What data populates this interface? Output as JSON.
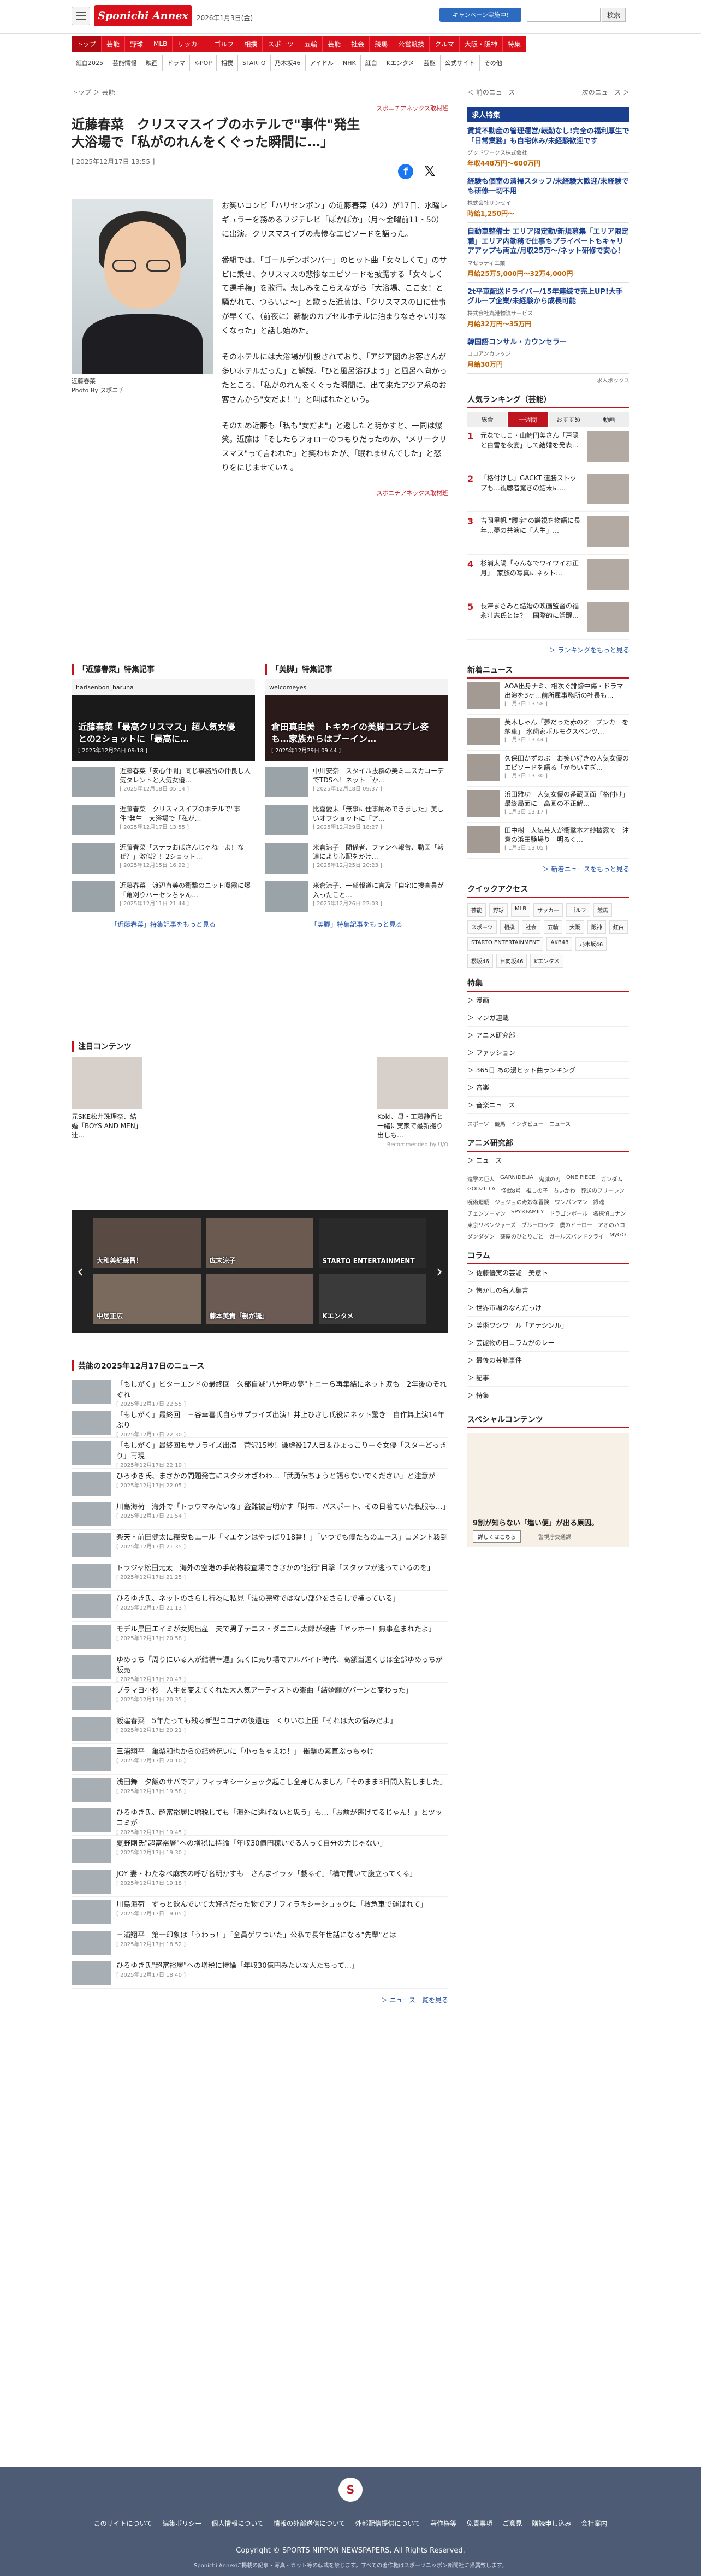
{
  "header": {
    "logo": "Sponichi Annex",
    "date": "2026年1月3日(金)",
    "campaign": "キャンペーン実施中!",
    "search_button": "検索",
    "categories": [
      "トップ",
      "芸能",
      "野球",
      "MLB",
      "サッカー",
      "ゴルフ",
      "相撲",
      "スポーツ",
      "五輪",
      "芸能",
      "社会",
      "競馬",
      "公営競技",
      "クルマ",
      "大阪・阪神",
      "特集"
    ],
    "subnav": [
      "紅白2025",
      "芸能情報",
      "映画",
      "ドラマ",
      "K-POP",
      "相撲",
      "STARTO",
      "乃木坂46",
      "アイドル",
      "NHK",
      "紅白",
      "Kエンタメ",
      "芸能",
      "公式サイト",
      "その他"
    ]
  },
  "breadcrumb": "トップ ＞ 芸能",
  "prevnext": {
    "prev": "＜ 前のニュース",
    "next": "次のニュース ＞"
  },
  "article": {
    "source": "スポニチアネックス取材班",
    "headline": "近藤春菜　クリスマスイブのホテルで\"事件\"発生　大浴場で「私がのれんをくぐった瞬間に…」",
    "meta": "[ 2025年12月17日 13:55 ]",
    "photo_caption_1": "近藤春菜",
    "photo_caption_2": "Photo By スポニチ",
    "paragraphs": [
      "お笑いコンビ「ハリセンボン」の近藤春菜（42）が17日、水曜レギュラーを務めるフジテレビ「ぽかぽか」（月〜金曜前11・50）に出演。クリスマスイブの悲惨なエピソードを語った。",
      "番組では、「ゴールデンボンバー」のヒット曲「女々しくて」のサビに乗せ、クリスマスの悲惨なエピソードを披露する「女々しくて選手権」を敢行。悲しみをこらえながら「大浴場、ここ女！と騒がれて、つらいよ〜」と歌った近藤は、「クリスマスの日に仕事が早くて、（前夜に）新橋のカプセルホテルに泊まりなきゃいけなくなった」と話し始めた。",
      "そのホテルには大浴場が併設されており、「アジア圏のお客さんが多いホテルだった」と解説。「ひと風呂浴びよう」と風呂へ向かったところ、「私がのれんをくぐった瞬間に、出て来たアジア系のお客さんから\"女だよ！\"」と叫ばれたという。",
      "そのため近藤も「私も\"女だよ\"」と返したと明かすと、一同は爆笑。近藤は「そしたらフォローのつもりだったのか、\"メリークリスマス\"って言われた」と笑わせたが、「眠れませんでした」と怒りをにじませていた。"
    ],
    "source_bottom": "スポニチアネックス取材班"
  },
  "features": [
    {
      "title": "「近藤春菜」特集記事",
      "video_head": "harisenbon_haruna",
      "video_text": "近藤春菜「最高クリスマス」超人気女優との2ショットに「最高に…",
      "video_time": "[ 2025年12月26日 09:18 ]",
      "items": [
        {
          "text": "近藤春菜「安心仲間」同じ事務所の仲良し人気タレントと人気女優…",
          "time": "[ 2025年12月18日 05:14 ]"
        },
        {
          "text": "近藤春菜　クリスマスイブのホテルで\"事件\"発生　大浴場で「私が…",
          "time": "[ 2025年12月17日 13:55 ]"
        },
        {
          "text": "近藤春菜「ステラおばさんじゃねーよ！なぜ？」激似？！2ショット…",
          "time": "[ 2025年12月15日 16:22 ]"
        },
        {
          "text": "近藤春菜　渡辺直美の衝撃のニット曝露に爆「角刈りハーセンちゃん…",
          "time": "[ 2025年12月11日 21:44 ]"
        }
      ],
      "more": "「近藤春菜」特集記事をもっと見る"
    },
    {
      "title": "「美脚」特集記事",
      "video_head": "welcomeyes",
      "video_text": "倉田真由美　トキカイの美脚コスプレ姿も…家族からはブーイン…",
      "video_time": "[ 2025年12月29日 09:44 ]",
      "items": [
        {
          "text": "中川安奈　スタイル抜群の美ミニスカコーデでTDSへ！ネット「か…",
          "time": "[ 2025年12月18日 09:37 ]"
        },
        {
          "text": "比嘉愛未「無事に仕事納めできました」美しいオフショットに「ア…",
          "time": "[ 2025年12月29日 18:27 ]"
        },
        {
          "text": "米倉涼子　関係者、ファンへ報告、動画「報道により心配をかけ…",
          "time": "[ 2025年12月25日 20:23 ]"
        },
        {
          "text": "米倉涼子、一部報道に言及「自宅に捜査員が入ったこと…",
          "time": "[ 2025年12月26日 22:03 ]"
        }
      ],
      "more": "「美脚」特集記事をもっと見る"
    }
  ],
  "notice": {
    "title": "注目コンテンツ",
    "items": [
      {
        "text": "元SKE松井珠理奈、結婚「BOYS AND MEN」辻…"
      },
      {
        "text": ""
      },
      {
        "text": ""
      },
      {
        "text": ""
      },
      {
        "text": "Koki、母・工藤静香と一緒に実家で最新撮り出しも…"
      }
    ],
    "credit": "Recommended by U/O"
  },
  "carousel": {
    "cells": [
      "大和美紀練習！",
      "広末涼子",
      "STARTO ENTERTAINMENT",
      "中居正広",
      "藤本美貴「親が誕」",
      "Kエンタメ"
    ],
    "left": "‹",
    "right": "›"
  },
  "daily": {
    "title": "芸能の2025年12月17日のニュース",
    "items": [
      {
        "text": "「もしがく」ビターエンドの最終回　久部自滅\"八分呪の夢\"トニーら再集結にネット涙も　2年後のそれぞれ",
        "time": "[ 2025年12月17日 22:55 ]"
      },
      {
        "text": "「もしがく」最終回　三谷幸喜氏自らサプライズ出演！井上ひさし氏役にネット驚き　自作舞上演14年ぶり",
        "time": "[ 2025年12月17日 22:30 ]"
      },
      {
        "text": "「もしがく」最終回もサプライズ出演　菅沢15秒！謙虚役17人目＆ひょっこりーぐ女優「スターどっきり」再現",
        "time": "[ 2025年12月17日 22:19 ]"
      },
      {
        "text": "ひろゆき氏、まさかの間題発言にスタジオざわわ…「武勇伝ちょうと語らないでください」と注意が",
        "time": "[ 2025年12月17日 22:05 ]"
      },
      {
        "text": "川島海荷　海外で「トラウマみたいな」盗難被害明かす「財布、パスポート、その日着ていた私服も…」",
        "time": "[ 2025年12月17日 21:54 ]"
      },
      {
        "text": "楽天・前田健太に糧安もエール「マエケンはやっぱり18番！」「いつでも僕たちのエース」コメント殺到",
        "time": "[ 2025年12月17日 21:35 ]"
      },
      {
        "text": "トラジャ松田元太　海外の空港の手荷物検査場できさかの\"犯行\"目撃「スタッフが逃っているのを」",
        "time": "[ 2025年12月17日 21:25 ]"
      },
      {
        "text": "ひろゆき氏、ネットのさらし行為に私見「法の完璧ではない部分をさらしで補っている」",
        "time": "[ 2025年12月17日 21:13 ]"
      },
      {
        "text": "モデル黒田エイミが女児出産　夫で男子テニス・ダニエル太郎が報告「ヤッホー！無事産まれたよ」",
        "time": "[ 2025年12月17日 20:58 ]"
      },
      {
        "text": "ゆめっち「周りにいる人が結構幸運」気くに売り場でアルバイト時代、高額当選くじは全部ゆめっちが販売",
        "time": "[ 2025年12月17日 20:47 ]"
      },
      {
        "text": "ブラマヨ小杉　人生を変えてくれた大人気アーティストの楽曲「結婚願がパーンと変わった」",
        "time": "[ 2025年12月17日 20:35 ]"
      },
      {
        "text": "飯窪春菜　5年たっても残る新型コロナの後遺症　くりいむ上田「それは大の悩みだよ」",
        "time": "[ 2025年12月17日 20:21 ]"
      },
      {
        "text": "三浦翔平　亀梨和也からの結婚祝いに「小っちゃえわ！」 衝撃の素直ぶっちゃけ",
        "time": "[ 2025年12月17日 20:10 ]"
      },
      {
        "text": "浅田舞　夕飯のサバでアナフィラキシーショック起こし全身じんましん「そのまま3日間入院しました」",
        "time": "[ 2025年12月17日 19:58 ]"
      },
      {
        "text": "ひろゆき氏、超富裕層に増税しても「海外に逃げないと思う」も…「お前が逃げてるじゃん！」とツッコミが",
        "time": "[ 2025年12月17日 19:45 ]"
      },
      {
        "text": "夏野剛氏\"超富裕層\"への増税に持論「年収30億円稼いでる人って自分の力じゃない」",
        "time": "[ 2025年12月17日 19:30 ]"
      },
      {
        "text": "JOY 妻・わたなべ麻衣の呼び名明かすも　さんまイラッ「戯るぞ」「構で聞いて腹立ってくる」",
        "time": "[ 2025年12月17日 19:18 ]"
      },
      {
        "text": "川島海荷　ずっと飲んでいて大好きだった物でアナフィラキシーショックに「救急車で運ばれて」",
        "time": "[ 2025年12月17日 19:05 ]"
      },
      {
        "text": "三浦翔平　第一印象は「うわっ！」「全員ゲワついた」公私で長年世話になる\"先輩\"とは",
        "time": "[ 2025年12月17日 18:52 ]"
      },
      {
        "text": "ひろゆき氏\"超富裕層\"への増税に持論「年収30億円みたいな人たちって…」",
        "time": "[ 2025年12月17日 18:40 ]"
      }
    ],
    "more": "＞ ニュース一覧を見る"
  },
  "side": {
    "jobs_title": "求人特集",
    "jobs": [
      {
        "title": "賃貸不動産の管理運営/転勤なし!完全の福利厚生で「日常業務」も自宅休み/未経験歓迎です",
        "company": "グッドワークス株式会社",
        "wage": "年収448万円〜600万円"
      },
      {
        "title": "経験も個室の清掃スタッフ/未経験大歓迎/未経験でも研修一切不用",
        "company": "株式会社サンセイ",
        "wage": "時給1,250円〜"
      },
      {
        "title": "自動車整備士 エリア限定勤/新規募集「エリア限定職」エリア内勤務で仕事もプライベートもキャリアアップも両立/月収25万〜/ネット研修で安心！",
        "company": "マセラティ工業",
        "wage": "月給25万5,000円〜32万4,000円"
      },
      {
        "title": "2t平車配送ドライバー/15年連続で売上UP!大手グループ企業/未経験から成長可能",
        "company": "株式会社丸港物流サービス",
        "wage": "月給32万円〜35万円"
      },
      {
        "title": "韓国語コンサル・カウンセラー",
        "company": "ココアンカレッジ",
        "wage": "月給30万円"
      }
    ],
    "jobs_credit": "求人ボックス",
    "rank_title": "人気ランキング（芸能）",
    "rank_tabs": [
      "総合",
      "一週間",
      "おすすめ",
      "動画"
    ],
    "rank": [
      {
        "no": "1",
        "text": "元なでしこ・山崎円美さん「戸隠と白雪を夜宴」して結婚を発表…"
      },
      {
        "no": "2",
        "text": "「格付けし」GACKT 連勝ストップも…視聴者驚きの結末に…"
      },
      {
        "no": "3",
        "text": "吉岡里帆 \"腰字\"の謙視を物語に長年…夢の共演に「人生」…"
      },
      {
        "no": "4",
        "text": "杉浦太陽「みんなでワイワイお正月」　家族の写真にネット…"
      },
      {
        "no": "5",
        "text": "長澤まさみと結婚の映画監督の福永壮志氏とは？　国際的に活躍…"
      }
    ],
    "rank_more": "＞ ランキングをもっと見る",
    "news_title": "新着ニュース",
    "news": [
      {
        "text": "AOA出身ナミ、相次ぐ誹謗中傷・ドラマ出演を3ヶ…前所属事務所の社長も…",
        "time": "[ 1月3日 13:58 ]"
      },
      {
        "text": "芙木しゃん「夢だった赤のオープンカーを納車」 氷歯家ボルモクスベンツ…",
        "time": "[ 1月3日 13:44 ]"
      },
      {
        "text": "久保田かずのぶ　お笑い好きの人気女優のエピソードを語る「かわいすぎ…",
        "time": "[ 1月3日 13:30 ]"
      },
      {
        "text": "浜田雅功　人気女優の番蔵画面「格付け」最終局面に　高画の不正解…",
        "time": "[ 1月3日 13:17 ]"
      },
      {
        "text": "田中樹　人気芸人が衝撃本才紗披露で　注意の浜田験場り　明るく…",
        "time": "[ 1月3日 13:05 ]"
      }
    ],
    "news_more": "＞ 新着ニュースをもっと見る",
    "qa_title": "クイックアクセス",
    "qa": [
      "芸能",
      "野球",
      "MLB",
      "サッカー",
      "ゴルフ",
      "競馬",
      "スポーツ",
      "相撲",
      "社会",
      "五輪",
      "大阪",
      "阪神",
      "紅白",
      "STARTO ENTERTAINMENT",
      "AKB48",
      "乃木坂46",
      "櫻坂46",
      "日向坂46",
      "Kエンタメ"
    ],
    "tokushu_title": "特集",
    "tokushu": [
      "＞ 漫画",
      "＞ マンガ連載",
      "＞ アニメ研究部",
      "＞ ファッション",
      "＞ 365日 あの漫ヒット曲ランキング",
      "＞ 音楽",
      "＞ 音楽ニュース"
    ],
    "tokushu_extra": [
      "スポーツ",
      "競馬",
      "インタビュー",
      "ニュース"
    ],
    "anime_title": "アニメ研究部",
    "anime_sub": "＞ ニュース",
    "anime_tags": [
      "進撃の巨人",
      "GARNiDELiA",
      "鬼滅の刃",
      "ONE PIECE",
      "ガンダム",
      "GODZILLA",
      "怪獣8号",
      "推しの子",
      "ちいかわ",
      "葬送のフリーレン",
      "呪術廻戦",
      "ジョジョの奇妙な冒険",
      "ワンパンマン",
      "銀魂",
      "チェンソーマン",
      "SPY×FAMILY",
      "ドラゴンボール",
      "名探偵コナン",
      "東京リベンジャーズ",
      "ブルーロック",
      "僕のヒーロー",
      "アオのハコ",
      "ダンダダン",
      "薬屋のひとりごと",
      "ガールズバンドクライ",
      "MyGO"
    ],
    "column_title": "コラム",
    "columns": [
      "＞ 佐藤優実の芸能　美意ト",
      "＞ 懐かしの名人集言",
      "＞ 世界市場のなんだっけ",
      "＞ 美術ワシワール「アテシンル」",
      "＞ 芸能物の日コラムがのレー",
      "＞ 最後の芸能事件",
      "＞ 記事",
      "＞ 特集"
    ],
    "special_title": "スペシャルコンテンツ",
    "ad_text": "9割が知らない「塩い便」が出る原因。",
    "ad_btn": "詳しくはこちら",
    "ad_name": "警視庁交通課"
  },
  "footer": {
    "logo": "S",
    "links": [
      "このサイトについて",
      "編集ポリシー",
      "個人情報について",
      "情報の外部送信について",
      "外部配信提供について",
      "著作権等",
      "免責事項",
      "ご意見",
      "購読申し込み",
      "会社案内"
    ],
    "copyright": "Copyright © SPORTS NIPPON NEWSPAPERS. All Rights Reserved.",
    "note": "Sponichi Annexに掲載の記事・写真・カット等の転載を禁じます。すべての著作権はスポーツニッポン新聞社に帰属致します。"
  }
}
